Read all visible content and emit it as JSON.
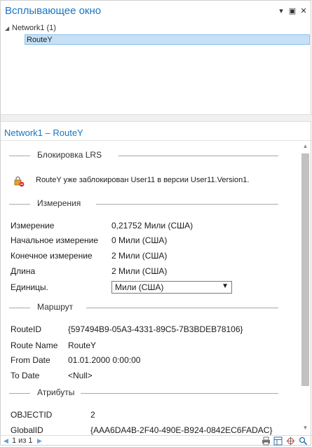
{
  "window": {
    "title": "Всплывающее окно",
    "controls": {
      "dropdown": "▾",
      "maximize": "▣",
      "close": "✕"
    }
  },
  "tree": {
    "root_label": "Network1 (1)",
    "child_label": "RouteY"
  },
  "detail": {
    "header": "Network1 – RouteY",
    "lock_section": {
      "title": "Блокировка LRS",
      "message": "RouteY уже заблокирован User11 в версии User11.Version1."
    },
    "measures_section": {
      "title": "Измерения",
      "rows": [
        {
          "label": "Измерение",
          "value": "0,21752 Мили (США)"
        },
        {
          "label": "Начальное измерение",
          "value": "0 Мили (США)"
        },
        {
          "label": "Конечное измерение",
          "value": "2 Мили (США)"
        },
        {
          "label": "Длина",
          "value": "2 Мили (США)"
        }
      ],
      "units_label": "Единицы.",
      "units_value": "Мили (США)"
    },
    "route_section": {
      "title": "Маршрут",
      "rows": [
        {
          "label": "RouteID",
          "value": "{597494B9-05A3-4331-89C5-7B3BDEB78106}"
        },
        {
          "label": "Route Name",
          "value": "RouteY"
        },
        {
          "label": "From Date",
          "value": "01.01.2000 0:00:00"
        },
        {
          "label": "To Date",
          "value": "<Null>"
        }
      ]
    },
    "attributes_section": {
      "title": "Атрибуты",
      "rows": [
        {
          "label": "OBJECTID",
          "value": "2"
        },
        {
          "label": "GlobalID",
          "value": "{AAA6DA4B-2F40-490E-B924-0842EC6FADAC}"
        }
      ]
    }
  },
  "status": {
    "page_text": "1 из 1"
  },
  "colors": {
    "accent": "#1a75c4",
    "selection": "#c6e0f5",
    "lock_red": "#d9262b"
  }
}
